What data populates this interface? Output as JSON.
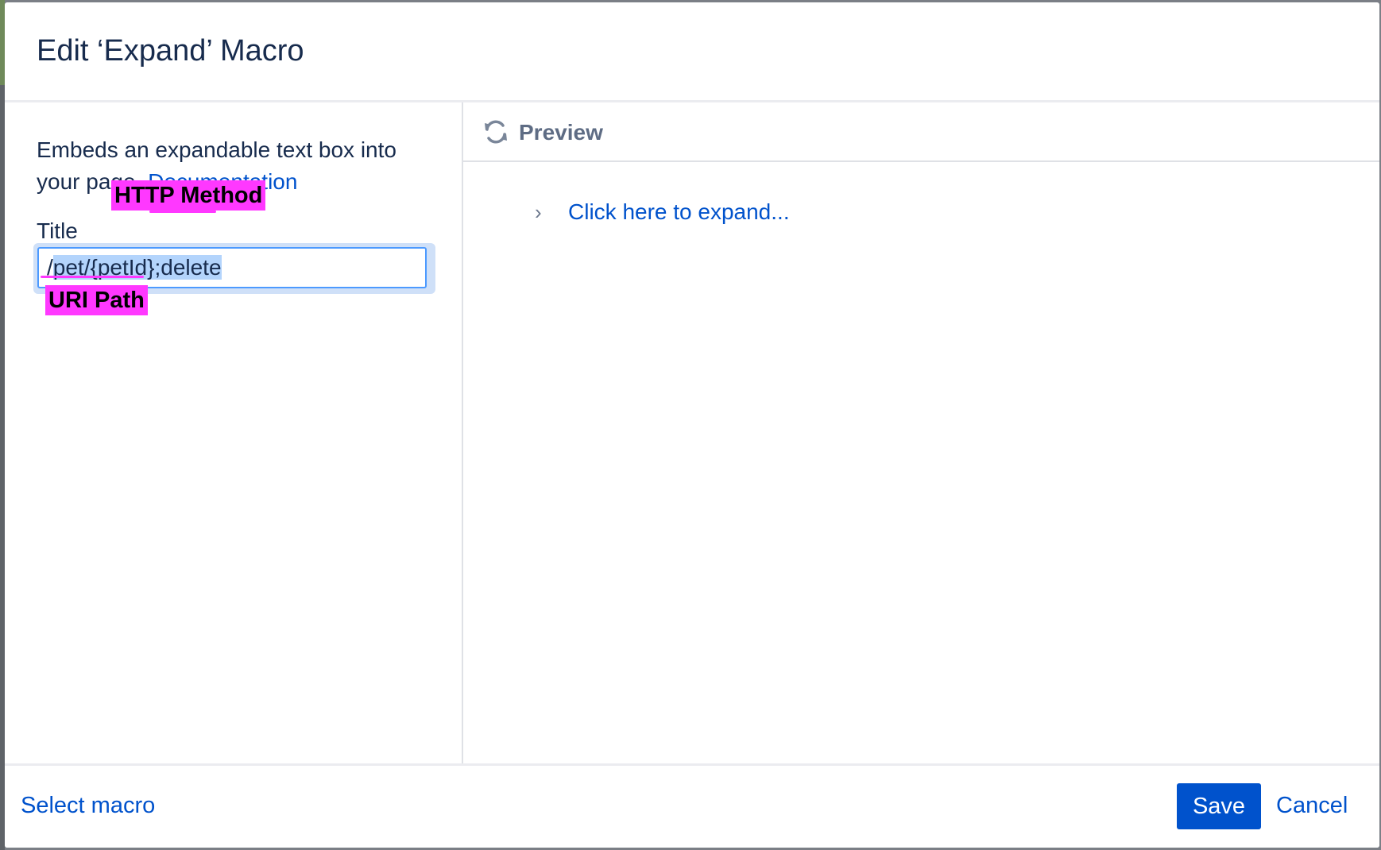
{
  "dialog": {
    "title": "Edit ‘Expand’ Macro",
    "description": "Embeds an expandable text box into your page.",
    "documentation_link": "Documentation",
    "title_field_label": "Title",
    "title_value_prefix": "/",
    "title_value_selected": "pet/{petId};delete"
  },
  "annotations": {
    "http_method": "HTTP Method",
    "uri_path": "URI Path",
    "color": "#ff38ff"
  },
  "preview": {
    "label": "Preview",
    "icon": "refresh-icon",
    "expand_icon": "chevron-right-icon",
    "expand_link": "Click here to expand..."
  },
  "footer": {
    "select_macro": "Select macro",
    "save": "Save",
    "cancel": "Cancel"
  },
  "colors": {
    "primary": "#0052cc",
    "text": "#172b4d",
    "focus_border": "#4c9aff"
  }
}
